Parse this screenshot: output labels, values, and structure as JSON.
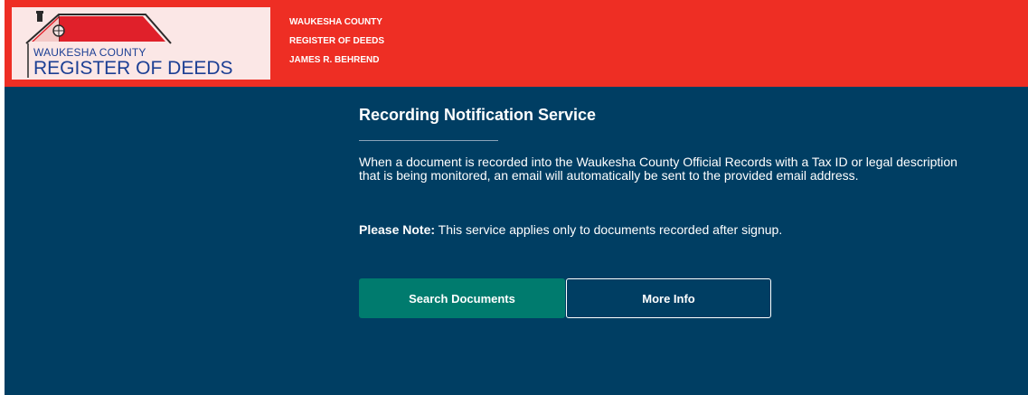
{
  "logo": {
    "line1": "WAUKESHA COUNTY",
    "line2": "REGISTER OF DEEDS",
    "roof_color": "#e0202a",
    "text_color": "#1c3f94",
    "icon": "house-roof-logo-icon"
  },
  "header": {
    "line1": "WAUKESHA COUNTY",
    "line2": "REGISTER OF DEEDS",
    "line3": "JAMES R. BEHREND",
    "background": "#ee2e24"
  },
  "main": {
    "title": "Recording Notification Service",
    "description": "When a document is recorded into the Waukesha County Official Records with a Tax ID or legal description that is being monitored, an email will automatically be sent to the provided email address.",
    "note_label": "Please Note:",
    "note_text": " This service applies only to documents recorded after signup.",
    "background": "#003e63"
  },
  "buttons": {
    "search_label": "Search Documents",
    "info_label": "More Info",
    "search_color": "#007b6e"
  }
}
